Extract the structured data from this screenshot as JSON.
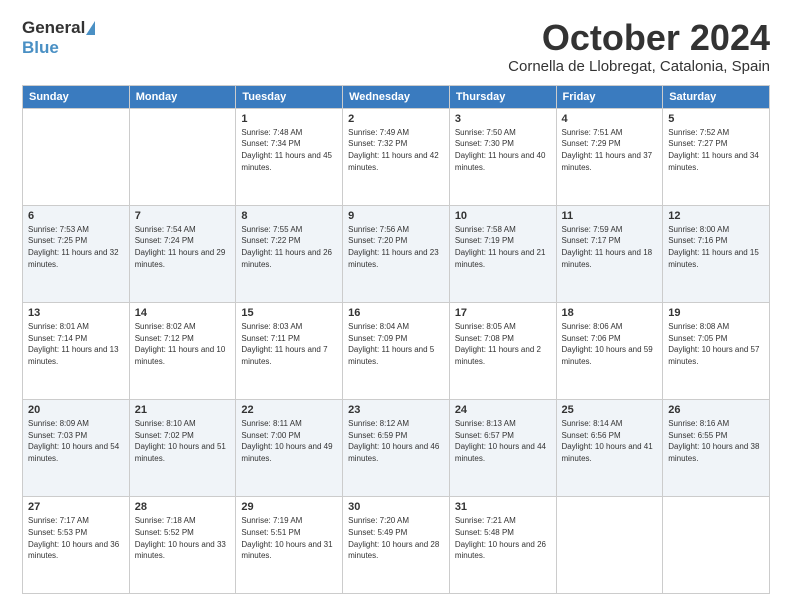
{
  "header": {
    "logo_general": "General",
    "logo_blue": "Blue",
    "month_title": "October 2024",
    "location": "Cornella de Llobregat, Catalonia, Spain"
  },
  "days_of_week": [
    "Sunday",
    "Monday",
    "Tuesday",
    "Wednesday",
    "Thursday",
    "Friday",
    "Saturday"
  ],
  "weeks": [
    [
      {
        "day": "",
        "sunrise": "",
        "sunset": "",
        "daylight": ""
      },
      {
        "day": "",
        "sunrise": "",
        "sunset": "",
        "daylight": ""
      },
      {
        "day": "1",
        "sunrise": "Sunrise: 7:48 AM",
        "sunset": "Sunset: 7:34 PM",
        "daylight": "Daylight: 11 hours and 45 minutes."
      },
      {
        "day": "2",
        "sunrise": "Sunrise: 7:49 AM",
        "sunset": "Sunset: 7:32 PM",
        "daylight": "Daylight: 11 hours and 42 minutes."
      },
      {
        "day": "3",
        "sunrise": "Sunrise: 7:50 AM",
        "sunset": "Sunset: 7:30 PM",
        "daylight": "Daylight: 11 hours and 40 minutes."
      },
      {
        "day": "4",
        "sunrise": "Sunrise: 7:51 AM",
        "sunset": "Sunset: 7:29 PM",
        "daylight": "Daylight: 11 hours and 37 minutes."
      },
      {
        "day": "5",
        "sunrise": "Sunrise: 7:52 AM",
        "sunset": "Sunset: 7:27 PM",
        "daylight": "Daylight: 11 hours and 34 minutes."
      }
    ],
    [
      {
        "day": "6",
        "sunrise": "Sunrise: 7:53 AM",
        "sunset": "Sunset: 7:25 PM",
        "daylight": "Daylight: 11 hours and 32 minutes."
      },
      {
        "day": "7",
        "sunrise": "Sunrise: 7:54 AM",
        "sunset": "Sunset: 7:24 PM",
        "daylight": "Daylight: 11 hours and 29 minutes."
      },
      {
        "day": "8",
        "sunrise": "Sunrise: 7:55 AM",
        "sunset": "Sunset: 7:22 PM",
        "daylight": "Daylight: 11 hours and 26 minutes."
      },
      {
        "day": "9",
        "sunrise": "Sunrise: 7:56 AM",
        "sunset": "Sunset: 7:20 PM",
        "daylight": "Daylight: 11 hours and 23 minutes."
      },
      {
        "day": "10",
        "sunrise": "Sunrise: 7:58 AM",
        "sunset": "Sunset: 7:19 PM",
        "daylight": "Daylight: 11 hours and 21 minutes."
      },
      {
        "day": "11",
        "sunrise": "Sunrise: 7:59 AM",
        "sunset": "Sunset: 7:17 PM",
        "daylight": "Daylight: 11 hours and 18 minutes."
      },
      {
        "day": "12",
        "sunrise": "Sunrise: 8:00 AM",
        "sunset": "Sunset: 7:16 PM",
        "daylight": "Daylight: 11 hours and 15 minutes."
      }
    ],
    [
      {
        "day": "13",
        "sunrise": "Sunrise: 8:01 AM",
        "sunset": "Sunset: 7:14 PM",
        "daylight": "Daylight: 11 hours and 13 minutes."
      },
      {
        "day": "14",
        "sunrise": "Sunrise: 8:02 AM",
        "sunset": "Sunset: 7:12 PM",
        "daylight": "Daylight: 11 hours and 10 minutes."
      },
      {
        "day": "15",
        "sunrise": "Sunrise: 8:03 AM",
        "sunset": "Sunset: 7:11 PM",
        "daylight": "Daylight: 11 hours and 7 minutes."
      },
      {
        "day": "16",
        "sunrise": "Sunrise: 8:04 AM",
        "sunset": "Sunset: 7:09 PM",
        "daylight": "Daylight: 11 hours and 5 minutes."
      },
      {
        "day": "17",
        "sunrise": "Sunrise: 8:05 AM",
        "sunset": "Sunset: 7:08 PM",
        "daylight": "Daylight: 11 hours and 2 minutes."
      },
      {
        "day": "18",
        "sunrise": "Sunrise: 8:06 AM",
        "sunset": "Sunset: 7:06 PM",
        "daylight": "Daylight: 10 hours and 59 minutes."
      },
      {
        "day": "19",
        "sunrise": "Sunrise: 8:08 AM",
        "sunset": "Sunset: 7:05 PM",
        "daylight": "Daylight: 10 hours and 57 minutes."
      }
    ],
    [
      {
        "day": "20",
        "sunrise": "Sunrise: 8:09 AM",
        "sunset": "Sunset: 7:03 PM",
        "daylight": "Daylight: 10 hours and 54 minutes."
      },
      {
        "day": "21",
        "sunrise": "Sunrise: 8:10 AM",
        "sunset": "Sunset: 7:02 PM",
        "daylight": "Daylight: 10 hours and 51 minutes."
      },
      {
        "day": "22",
        "sunrise": "Sunrise: 8:11 AM",
        "sunset": "Sunset: 7:00 PM",
        "daylight": "Daylight: 10 hours and 49 minutes."
      },
      {
        "day": "23",
        "sunrise": "Sunrise: 8:12 AM",
        "sunset": "Sunset: 6:59 PM",
        "daylight": "Daylight: 10 hours and 46 minutes."
      },
      {
        "day": "24",
        "sunrise": "Sunrise: 8:13 AM",
        "sunset": "Sunset: 6:57 PM",
        "daylight": "Daylight: 10 hours and 44 minutes."
      },
      {
        "day": "25",
        "sunrise": "Sunrise: 8:14 AM",
        "sunset": "Sunset: 6:56 PM",
        "daylight": "Daylight: 10 hours and 41 minutes."
      },
      {
        "day": "26",
        "sunrise": "Sunrise: 8:16 AM",
        "sunset": "Sunset: 6:55 PM",
        "daylight": "Daylight: 10 hours and 38 minutes."
      }
    ],
    [
      {
        "day": "27",
        "sunrise": "Sunrise: 7:17 AM",
        "sunset": "Sunset: 5:53 PM",
        "daylight": "Daylight: 10 hours and 36 minutes."
      },
      {
        "day": "28",
        "sunrise": "Sunrise: 7:18 AM",
        "sunset": "Sunset: 5:52 PM",
        "daylight": "Daylight: 10 hours and 33 minutes."
      },
      {
        "day": "29",
        "sunrise": "Sunrise: 7:19 AM",
        "sunset": "Sunset: 5:51 PM",
        "daylight": "Daylight: 10 hours and 31 minutes."
      },
      {
        "day": "30",
        "sunrise": "Sunrise: 7:20 AM",
        "sunset": "Sunset: 5:49 PM",
        "daylight": "Daylight: 10 hours and 28 minutes."
      },
      {
        "day": "31",
        "sunrise": "Sunrise: 7:21 AM",
        "sunset": "Sunset: 5:48 PM",
        "daylight": "Daylight: 10 hours and 26 minutes."
      },
      {
        "day": "",
        "sunrise": "",
        "sunset": "",
        "daylight": ""
      },
      {
        "day": "",
        "sunrise": "",
        "sunset": "",
        "daylight": ""
      }
    ]
  ]
}
